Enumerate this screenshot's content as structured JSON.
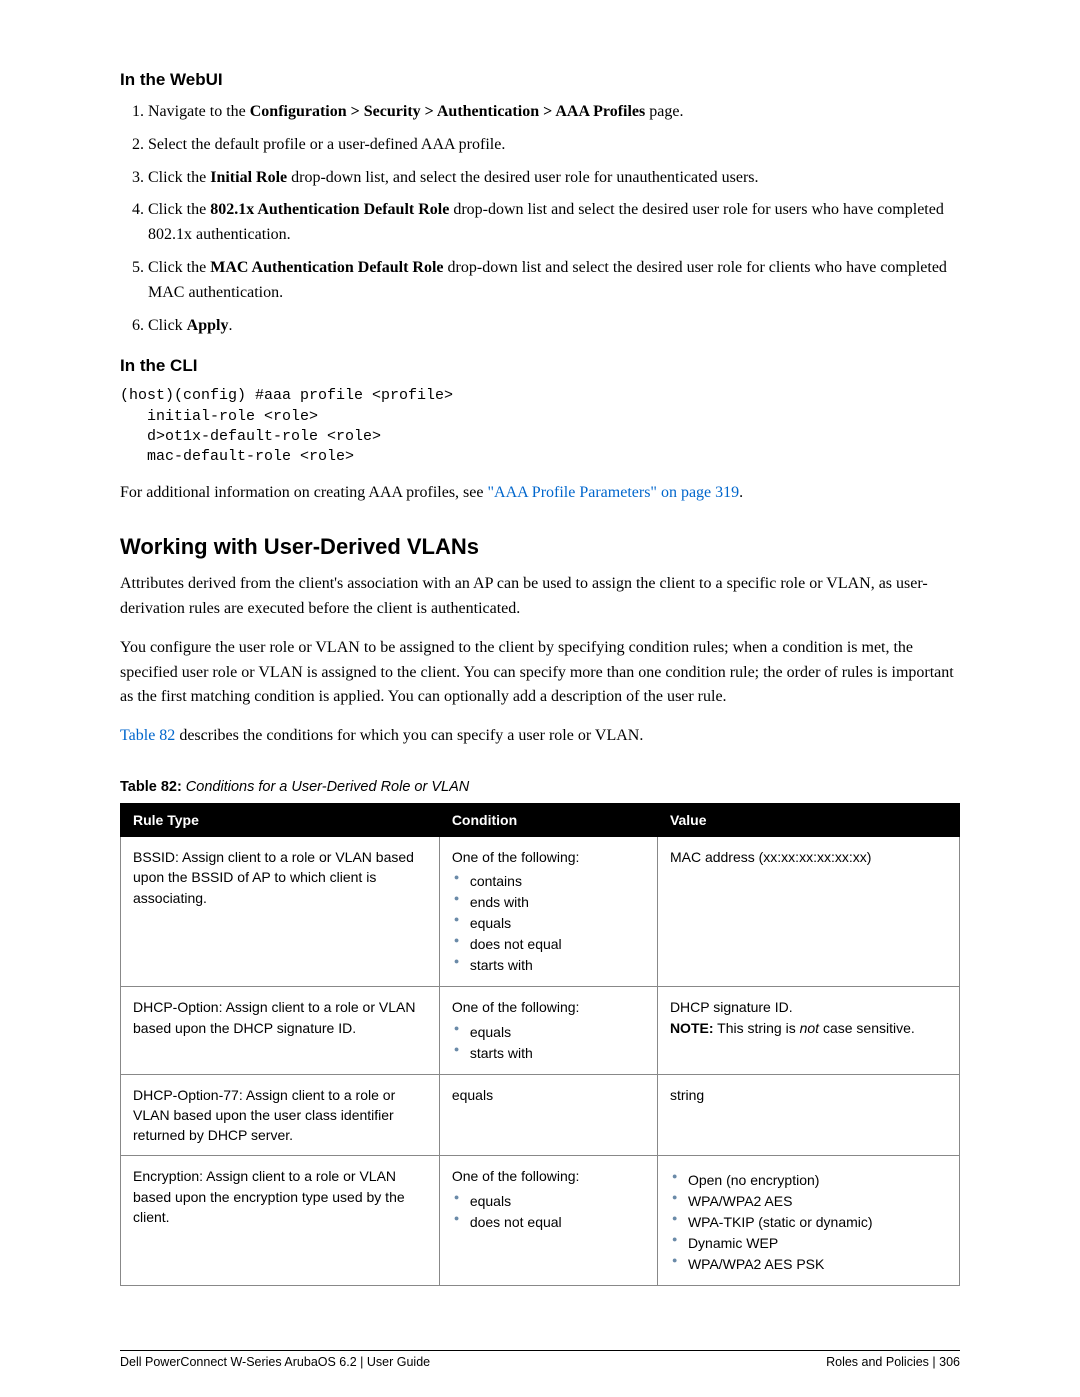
{
  "headings": {
    "webui": "In the WebUI",
    "cli": "In the CLI",
    "section": "Working with User-Derived VLANs"
  },
  "webui_steps": {
    "s1_pre": "Navigate to the ",
    "s1_bold": "Configuration > Security > Authentication > AAA Profiles",
    "s1_post": " page.",
    "s2": "Select the default profile or a user-defined AAA profile.",
    "s3_pre": "Click the ",
    "s3_bold": "Initial Role",
    "s3_post": " drop-down list, and select the desired user role for unauthenticated users.",
    "s4_pre": "Click the ",
    "s4_bold": "802.1x Authentication Default Role",
    "s4_post": " drop-down list and select the desired user role for users who have completed 802.1x authentication.",
    "s5_pre": "Click the ",
    "s5_bold": "MAC Authentication Default Role",
    "s5_post": " drop-down list and select the desired user role for clients who have completed MAC authentication.",
    "s6_pre": "Click ",
    "s6_bold": "Apply",
    "s6_post": "."
  },
  "cli_block": "(host)(config) #aaa profile <profile>\n   initial-role <role>\n   d>ot1x-default-role <role>\n   mac-default-role <role>",
  "cli_note_pre": "For additional information on creating AAA profiles, see ",
  "cli_note_link": "\"AAA Profile Parameters\" on page 319",
  "cli_note_post": ".",
  "section_p1": "Attributes derived from the client's association with an AP can be used to assign the client to a specific role or VLAN, as user-derivation rules are executed before the client is authenticated.",
  "section_p2": "You configure the user role or VLAN to be assigned to the client by specifying condition rules; when a condition is met, the specified user role or VLAN is assigned to the client. You can specify more than one condition rule; the order of rules is important as the first matching condition is applied. You can optionally add a description of the user rule.",
  "section_p3_link": "Table 82",
  "section_p3_post": " describes the conditions for which you can specify a user role or VLAN.",
  "table_caption_bold": "Table 82:",
  "table_caption_italic": " Conditions for a User-Derived Role or VLAN",
  "table": {
    "headers": {
      "c1": "Rule Type",
      "c2": "Condition",
      "c3": "Value"
    },
    "r1": {
      "rule": "BSSID: Assign client to a role or VLAN based upon the BSSID of AP to which client is associating.",
      "cond_intro": "One of the following:",
      "cond_items": [
        "contains",
        "ends with",
        "equals",
        "does not equal",
        "starts with"
      ],
      "value": "MAC address (xx:xx:xx:xx:xx:xx)"
    },
    "r2": {
      "rule": "DHCP-Option: Assign client to a role or VLAN based upon the DHCP signature ID.",
      "cond_intro": "One of the following:",
      "cond_items": [
        "equals",
        "starts with"
      ],
      "value_line1": "DHCP signature ID.",
      "value_note_bold": "NOTE:",
      "value_note_mid": " This string is ",
      "value_note_italic": "not",
      "value_note_post": " case sensitive."
    },
    "r3": {
      "rule": "DHCP-Option-77: Assign client to a role or VLAN based upon the user class identifier returned by DHCP server.",
      "cond": "equals",
      "value": "string"
    },
    "r4": {
      "rule": "Encryption: Assign client to a role or VLAN based upon the encryption type used by the client.",
      "cond_intro": "One of the following:",
      "cond_items": [
        "equals",
        "does not equal"
      ],
      "value_items": [
        "Open (no encryption)",
        "WPA/WPA2 AES",
        "WPA-TKIP (static or dynamic)",
        "Dynamic WEP",
        "WPA/WPA2 AES PSK"
      ]
    }
  },
  "footer": {
    "left": "Dell PowerConnect W-Series ArubaOS 6.2",
    "left2": "  |  User Guide",
    "right_label": "Roles and Policies",
    "right_sep": "  |  ",
    "right_page": "306"
  }
}
